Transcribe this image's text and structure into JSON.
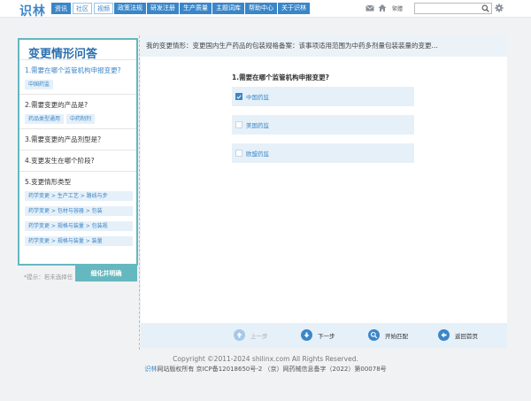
{
  "header": {
    "logo": "识林",
    "small_nav": [
      "资讯",
      "社区",
      "视频"
    ],
    "main_nav": [
      "政策法规",
      "研发注册",
      "生产质量",
      "主题词库",
      "帮助中心",
      "关于识林"
    ],
    "lang": "繁體",
    "search": {
      "value": "",
      "placeholder": ""
    }
  },
  "left": {
    "title": "变更情形问答",
    "questions": [
      {
        "title": "1.需要在哪个监管机构申报变更?",
        "tags": [
          "中国药监"
        ]
      },
      {
        "title": "2.需要变更的产品是?",
        "tags": [
          "药品类型通用",
          "中药制剂"
        ]
      },
      {
        "title": "3.需要变更的产品剂型是？",
        "tags": []
      },
      {
        "title": "4.变更发生在哪个阶段?",
        "tags": []
      },
      {
        "title": "5.变更情形类型",
        "tags": [
          "药学变更 > 生产工艺 > 路线与步",
          "药学变更 > 包材与容器 > 包装",
          "药学变更 > 规格与装量 > 包装规",
          "药学变更 > 规格与装量 > 装量"
        ]
      }
    ],
    "tips": "*提示：若未选择任",
    "tip_button": "细化并明确"
  },
  "right": {
    "info": "我的变更情形：变更国内生产药品的包装规格备案：该事项适用范围为中药多剂量包装装量的变更...",
    "question": "1.需要在哪个监管机构申报变更?",
    "options": [
      {
        "label": "中国药监",
        "checked": true
      },
      {
        "label": "美国药监",
        "checked": false
      },
      {
        "label": "欧盟药监",
        "checked": false
      }
    ]
  },
  "actions": {
    "prev": "上一步",
    "next": "下一步",
    "match": "开始匹配",
    "home": "返回首页"
  },
  "footer": {
    "copyright": "Copyright ©2011-2024 shilinx.com All Rights Reserved.",
    "brand": "识林",
    "icp": "网站版权所有 京ICP备12018650号-2 （京）网药械信息备字（2022）第00078号"
  },
  "colors": {
    "accent": "#3a86c8",
    "teal": "#65b8bf",
    "light": "#e6f0f8"
  }
}
